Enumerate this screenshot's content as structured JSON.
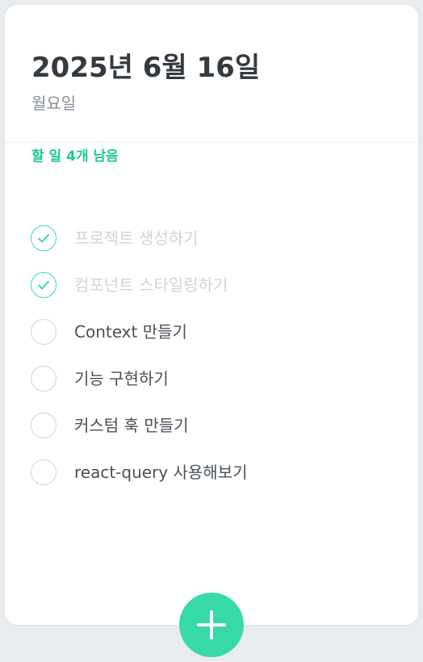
{
  "header": {
    "date": "2025년 6월 16일",
    "day": "월요일",
    "tasks_left": "할 일 4개 남음"
  },
  "todos": [
    {
      "text": "프로젝트 생성하기",
      "done": true
    },
    {
      "text": "컴포넌트 스타일링하기",
      "done": true
    },
    {
      "text": "Context 만들기",
      "done": false
    },
    {
      "text": "기능 구현하기",
      "done": false
    },
    {
      "text": "커스텀 훅 만들기",
      "done": false
    },
    {
      "text": "react-query 사용해보기",
      "done": false
    }
  ],
  "add_button": {
    "icon": "plus-icon"
  },
  "colors": {
    "accent": "#20c997",
    "check": "#38d9a9",
    "done_text": "#ced4da",
    "text": "#495057",
    "background": "#e9ecef"
  }
}
